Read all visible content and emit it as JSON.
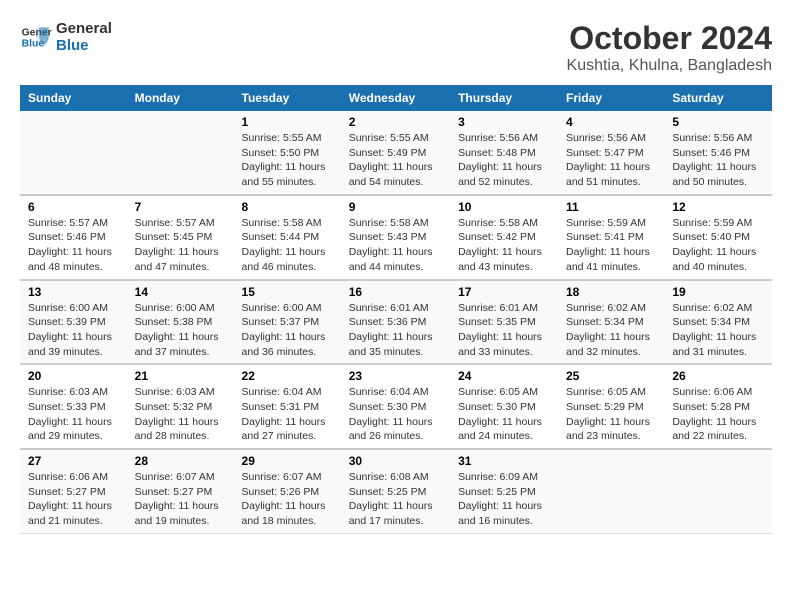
{
  "logo": {
    "name": "General",
    "name2": "Blue"
  },
  "title": "October 2024",
  "subtitle": "Kushtia, Khulna, Bangladesh",
  "days_header": [
    "Sunday",
    "Monday",
    "Tuesday",
    "Wednesday",
    "Thursday",
    "Friday",
    "Saturday"
  ],
  "weeks": [
    [
      {
        "day": "",
        "sunrise": "",
        "sunset": "",
        "daylight": ""
      },
      {
        "day": "",
        "sunrise": "",
        "sunset": "",
        "daylight": ""
      },
      {
        "day": "1",
        "sunrise": "Sunrise: 5:55 AM",
        "sunset": "Sunset: 5:50 PM",
        "daylight": "Daylight: 11 hours and 55 minutes."
      },
      {
        "day": "2",
        "sunrise": "Sunrise: 5:55 AM",
        "sunset": "Sunset: 5:49 PM",
        "daylight": "Daylight: 11 hours and 54 minutes."
      },
      {
        "day": "3",
        "sunrise": "Sunrise: 5:56 AM",
        "sunset": "Sunset: 5:48 PM",
        "daylight": "Daylight: 11 hours and 52 minutes."
      },
      {
        "day": "4",
        "sunrise": "Sunrise: 5:56 AM",
        "sunset": "Sunset: 5:47 PM",
        "daylight": "Daylight: 11 hours and 51 minutes."
      },
      {
        "day": "5",
        "sunrise": "Sunrise: 5:56 AM",
        "sunset": "Sunset: 5:46 PM",
        "daylight": "Daylight: 11 hours and 50 minutes."
      }
    ],
    [
      {
        "day": "6",
        "sunrise": "Sunrise: 5:57 AM",
        "sunset": "Sunset: 5:46 PM",
        "daylight": "Daylight: 11 hours and 48 minutes."
      },
      {
        "day": "7",
        "sunrise": "Sunrise: 5:57 AM",
        "sunset": "Sunset: 5:45 PM",
        "daylight": "Daylight: 11 hours and 47 minutes."
      },
      {
        "day": "8",
        "sunrise": "Sunrise: 5:58 AM",
        "sunset": "Sunset: 5:44 PM",
        "daylight": "Daylight: 11 hours and 46 minutes."
      },
      {
        "day": "9",
        "sunrise": "Sunrise: 5:58 AM",
        "sunset": "Sunset: 5:43 PM",
        "daylight": "Daylight: 11 hours and 44 minutes."
      },
      {
        "day": "10",
        "sunrise": "Sunrise: 5:58 AM",
        "sunset": "Sunset: 5:42 PM",
        "daylight": "Daylight: 11 hours and 43 minutes."
      },
      {
        "day": "11",
        "sunrise": "Sunrise: 5:59 AM",
        "sunset": "Sunset: 5:41 PM",
        "daylight": "Daylight: 11 hours and 41 minutes."
      },
      {
        "day": "12",
        "sunrise": "Sunrise: 5:59 AM",
        "sunset": "Sunset: 5:40 PM",
        "daylight": "Daylight: 11 hours and 40 minutes."
      }
    ],
    [
      {
        "day": "13",
        "sunrise": "Sunrise: 6:00 AM",
        "sunset": "Sunset: 5:39 PM",
        "daylight": "Daylight: 11 hours and 39 minutes."
      },
      {
        "day": "14",
        "sunrise": "Sunrise: 6:00 AM",
        "sunset": "Sunset: 5:38 PM",
        "daylight": "Daylight: 11 hours and 37 minutes."
      },
      {
        "day": "15",
        "sunrise": "Sunrise: 6:00 AM",
        "sunset": "Sunset: 5:37 PM",
        "daylight": "Daylight: 11 hours and 36 minutes."
      },
      {
        "day": "16",
        "sunrise": "Sunrise: 6:01 AM",
        "sunset": "Sunset: 5:36 PM",
        "daylight": "Daylight: 11 hours and 35 minutes."
      },
      {
        "day": "17",
        "sunrise": "Sunrise: 6:01 AM",
        "sunset": "Sunset: 5:35 PM",
        "daylight": "Daylight: 11 hours and 33 minutes."
      },
      {
        "day": "18",
        "sunrise": "Sunrise: 6:02 AM",
        "sunset": "Sunset: 5:34 PM",
        "daylight": "Daylight: 11 hours and 32 minutes."
      },
      {
        "day": "19",
        "sunrise": "Sunrise: 6:02 AM",
        "sunset": "Sunset: 5:34 PM",
        "daylight": "Daylight: 11 hours and 31 minutes."
      }
    ],
    [
      {
        "day": "20",
        "sunrise": "Sunrise: 6:03 AM",
        "sunset": "Sunset: 5:33 PM",
        "daylight": "Daylight: 11 hours and 29 minutes."
      },
      {
        "day": "21",
        "sunrise": "Sunrise: 6:03 AM",
        "sunset": "Sunset: 5:32 PM",
        "daylight": "Daylight: 11 hours and 28 minutes."
      },
      {
        "day": "22",
        "sunrise": "Sunrise: 6:04 AM",
        "sunset": "Sunset: 5:31 PM",
        "daylight": "Daylight: 11 hours and 27 minutes."
      },
      {
        "day": "23",
        "sunrise": "Sunrise: 6:04 AM",
        "sunset": "Sunset: 5:30 PM",
        "daylight": "Daylight: 11 hours and 26 minutes."
      },
      {
        "day": "24",
        "sunrise": "Sunrise: 6:05 AM",
        "sunset": "Sunset: 5:30 PM",
        "daylight": "Daylight: 11 hours and 24 minutes."
      },
      {
        "day": "25",
        "sunrise": "Sunrise: 6:05 AM",
        "sunset": "Sunset: 5:29 PM",
        "daylight": "Daylight: 11 hours and 23 minutes."
      },
      {
        "day": "26",
        "sunrise": "Sunrise: 6:06 AM",
        "sunset": "Sunset: 5:28 PM",
        "daylight": "Daylight: 11 hours and 22 minutes."
      }
    ],
    [
      {
        "day": "27",
        "sunrise": "Sunrise: 6:06 AM",
        "sunset": "Sunset: 5:27 PM",
        "daylight": "Daylight: 11 hours and 21 minutes."
      },
      {
        "day": "28",
        "sunrise": "Sunrise: 6:07 AM",
        "sunset": "Sunset: 5:27 PM",
        "daylight": "Daylight: 11 hours and 19 minutes."
      },
      {
        "day": "29",
        "sunrise": "Sunrise: 6:07 AM",
        "sunset": "Sunset: 5:26 PM",
        "daylight": "Daylight: 11 hours and 18 minutes."
      },
      {
        "day": "30",
        "sunrise": "Sunrise: 6:08 AM",
        "sunset": "Sunset: 5:25 PM",
        "daylight": "Daylight: 11 hours and 17 minutes."
      },
      {
        "day": "31",
        "sunrise": "Sunrise: 6:09 AM",
        "sunset": "Sunset: 5:25 PM",
        "daylight": "Daylight: 11 hours and 16 minutes."
      },
      {
        "day": "",
        "sunrise": "",
        "sunset": "",
        "daylight": ""
      },
      {
        "day": "",
        "sunrise": "",
        "sunset": "",
        "daylight": ""
      }
    ]
  ]
}
